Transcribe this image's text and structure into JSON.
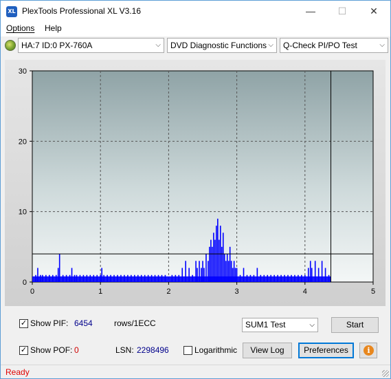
{
  "window": {
    "title": "PlexTools Professional XL V3.16",
    "app_icon_text": "XL",
    "min_glyph": "—",
    "max_glyph": "☐",
    "close_glyph": "✕"
  },
  "menu": {
    "items": [
      {
        "label": "Options",
        "accel": "O"
      },
      {
        "label": "Help",
        "accel": "H"
      }
    ]
  },
  "toolbar": {
    "drive": "HA:7 ID:0  PX-760A",
    "function": "DVD Diagnostic Functions",
    "test": "Q-Check PI/PO Test",
    "dropdown_glyph": "⌵"
  },
  "chart_data": {
    "type": "bar",
    "x_ticks": [
      "0",
      "1",
      "2",
      "3",
      "4",
      "5"
    ],
    "y_ticks": [
      "0",
      "10",
      "20",
      "30"
    ],
    "xlim": [
      0,
      5
    ],
    "ylim": [
      0,
      30
    ],
    "threshold_line": 4,
    "end_marker_x": 4.38,
    "grid": true,
    "series": [
      {
        "color": "#0000ff",
        "samples": [
          [
            0.05,
            1
          ],
          [
            0.08,
            2
          ],
          [
            0.12,
            1
          ],
          [
            0.15,
            1
          ],
          [
            0.2,
            1
          ],
          [
            0.25,
            1
          ],
          [
            0.3,
            1
          ],
          [
            0.35,
            1
          ],
          [
            0.38,
            2
          ],
          [
            0.4,
            4
          ],
          [
            0.45,
            1
          ],
          [
            0.5,
            1
          ],
          [
            0.55,
            1
          ],
          [
            0.58,
            2
          ],
          [
            0.62,
            1
          ],
          [
            0.65,
            1
          ],
          [
            0.7,
            1
          ],
          [
            0.75,
            1
          ],
          [
            0.8,
            1
          ],
          [
            0.85,
            1
          ],
          [
            0.9,
            1
          ],
          [
            0.95,
            1
          ],
          [
            1.0,
            1
          ],
          [
            1.02,
            2
          ],
          [
            1.05,
            1
          ],
          [
            1.1,
            1
          ],
          [
            1.15,
            1
          ],
          [
            1.2,
            1
          ],
          [
            1.25,
            1
          ],
          [
            1.3,
            1
          ],
          [
            1.35,
            1
          ],
          [
            1.4,
            1
          ],
          [
            1.45,
            1
          ],
          [
            1.5,
            1
          ],
          [
            1.55,
            1
          ],
          [
            1.6,
            1
          ],
          [
            1.65,
            1
          ],
          [
            1.7,
            1
          ],
          [
            1.75,
            1
          ],
          [
            1.8,
            1
          ],
          [
            1.85,
            1
          ],
          [
            1.9,
            1
          ],
          [
            1.95,
            1
          ],
          [
            2.05,
            1
          ],
          [
            2.1,
            1
          ],
          [
            2.15,
            1
          ],
          [
            2.2,
            2
          ],
          [
            2.25,
            3
          ],
          [
            2.3,
            2
          ],
          [
            2.35,
            1
          ],
          [
            2.4,
            3
          ],
          [
            2.42,
            2
          ],
          [
            2.45,
            3
          ],
          [
            2.48,
            2
          ],
          [
            2.5,
            3
          ],
          [
            2.52,
            2
          ],
          [
            2.55,
            4
          ],
          [
            2.58,
            3
          ],
          [
            2.6,
            5
          ],
          [
            2.62,
            6
          ],
          [
            2.64,
            5
          ],
          [
            2.66,
            7
          ],
          [
            2.68,
            6
          ],
          [
            2.7,
            8
          ],
          [
            2.72,
            9
          ],
          [
            2.74,
            6
          ],
          [
            2.76,
            8
          ],
          [
            2.78,
            5
          ],
          [
            2.8,
            7
          ],
          [
            2.82,
            4
          ],
          [
            2.84,
            3
          ],
          [
            2.86,
            4
          ],
          [
            2.88,
            3
          ],
          [
            2.9,
            5
          ],
          [
            2.92,
            3
          ],
          [
            2.94,
            2
          ],
          [
            2.96,
            3
          ],
          [
            2.98,
            2
          ],
          [
            3.0,
            2
          ],
          [
            3.05,
            1
          ],
          [
            3.1,
            2
          ],
          [
            3.15,
            1
          ],
          [
            3.2,
            1
          ],
          [
            3.25,
            1
          ],
          [
            3.3,
            2
          ],
          [
            3.35,
            1
          ],
          [
            3.4,
            1
          ],
          [
            3.45,
            1
          ],
          [
            3.5,
            1
          ],
          [
            3.55,
            1
          ],
          [
            3.6,
            1
          ],
          [
            3.65,
            1
          ],
          [
            3.7,
            1
          ],
          [
            3.75,
            1
          ],
          [
            3.8,
            1
          ],
          [
            3.85,
            1
          ],
          [
            3.9,
            1
          ],
          [
            3.95,
            1
          ],
          [
            4.0,
            1
          ],
          [
            4.05,
            2
          ],
          [
            4.08,
            3
          ],
          [
            4.1,
            2
          ],
          [
            4.15,
            3
          ],
          [
            4.2,
            2
          ],
          [
            4.25,
            3
          ],
          [
            4.3,
            2
          ],
          [
            4.35,
            1
          ]
        ]
      }
    ]
  },
  "controls": {
    "show_pif_label": "Show PIF:",
    "show_pif_accel": "F",
    "show_pif_checked": true,
    "pif_value": "6454",
    "rows_label": "rows/1ECC",
    "show_pof_label": "Show POF:",
    "show_pof_accel": "F",
    "show_pof_checked": true,
    "pof_value": "0",
    "lsn_label": "LSN:",
    "lsn_value": "2298496",
    "logarithmic_label": "Logarithmic",
    "logarithmic_checked": false,
    "sum_select": "SUM1 Test",
    "start_label": "Start",
    "view_log_label": "View Log",
    "preferences_label": "Preferences",
    "info_glyph": "i",
    "check_glyph": "✓"
  },
  "status": {
    "text": "Ready"
  }
}
